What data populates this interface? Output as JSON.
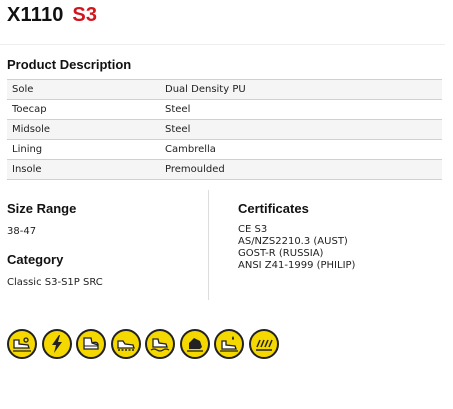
{
  "title": {
    "code": "X1110",
    "rating": "S3"
  },
  "product_description": {
    "heading": "Product Description",
    "rows": [
      {
        "key": "Sole",
        "value": "Dual Density PU"
      },
      {
        "key": "Toecap",
        "value": "Steel"
      },
      {
        "key": "Midsole",
        "value": "Steel"
      },
      {
        "key": "Lining",
        "value": "Cambrella"
      },
      {
        "key": "Insole",
        "value": "Premoulded"
      }
    ]
  },
  "size_range": {
    "heading": "Size Range",
    "value": "38-47"
  },
  "category": {
    "heading": "Category",
    "value": "Classic S3-S1P SRC"
  },
  "certificates": {
    "heading": "Certificates",
    "items": [
      "CE S3",
      "AS/NZS2210.3 (AUST)",
      "GOST-R (RUSSIA)",
      "ANSI Z41-1999 (PHILIP)"
    ]
  },
  "feature_icons": [
    "boot-slip-resistant-icon",
    "antistatic-lightning-icon",
    "toecap-protection-icon",
    "midsole-penetration-icon",
    "water-resistant-icon",
    "energy-absorbing-heel-icon",
    "oil-resistant-sole-icon",
    "heat-resistant-sole-icon"
  ],
  "colors": {
    "rating": "#d0151c",
    "icon_fill": "#f5d800"
  }
}
